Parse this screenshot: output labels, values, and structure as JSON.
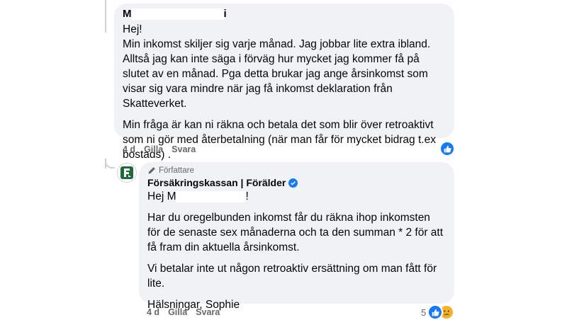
{
  "comment1": {
    "author_initial": "M",
    "author_trailing": "i",
    "paragraphs": [
      "Hej!",
      "Min inkomst skiljer sig varje månad. Jag jobbar lite extra ibland. Alltså jag kan inte säga i förväg hur mycket jag kommer få på slutet av en månad. Pga detta brukar jag ange årsinkomst som visar sig vara mindre när jag få inkomst deklaration från Skatteverket.",
      "Min fråga är kan ni räkna och betala det som blir över retroaktivt som ni gör med återbetalning (när man får för mycket bidrag t.ex bostads) ."
    ],
    "time": "4 d",
    "like_label": "Gilla",
    "reply_label": "Svara"
  },
  "comment2": {
    "badge": "Författare",
    "author": "Försäkringskassan | Förälder",
    "greeting_start": "Hej M",
    "greeting_end": "!",
    "paragraphs": [
      "Har du oregelbunden inkomst får du räkna ihop inkomsten för de senaste sex månaderna och ta den summan * 2 för att få fram din aktuella årsinkomst.",
      "Vi betalar inte ut någon retroaktiv ersättning om man fått för lite.",
      "Hälsningar, Sophie"
    ],
    "time": "4 d",
    "like_label": "Gilla",
    "reply_label": "Svara",
    "reaction_count": "5"
  },
  "colors": {
    "bubble_bg": "#f0f2f5",
    "secondary_text": "#65676b",
    "like_blue": "#1877f2",
    "brand_green": "#1f6b3a"
  }
}
